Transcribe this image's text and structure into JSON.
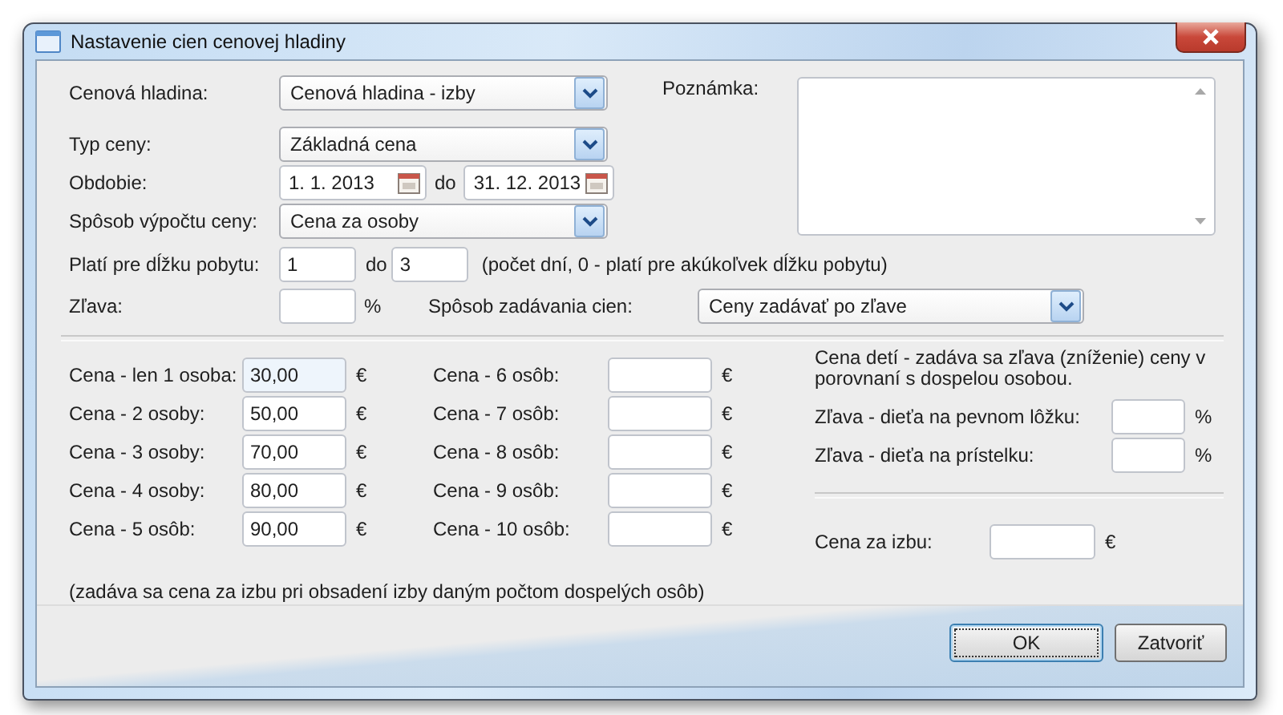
{
  "window": {
    "title": "Nastavenie cien cenovej hladiny"
  },
  "price_level": {
    "label": "Cenová hladina:",
    "value": "Cenová hladina - izby"
  },
  "price_type": {
    "label": "Typ ceny:",
    "value": "Základná cena"
  },
  "period": {
    "label": "Obdobie:",
    "from": "1. 1. 2013",
    "separator": "do",
    "to": "31. 12. 2013"
  },
  "calc_method": {
    "label": "Spôsob výpočtu ceny:",
    "value": "Cena za osoby"
  },
  "note": {
    "label": "Poznámka:"
  },
  "stay_length": {
    "label": "Platí pre dĺžku pobytu:",
    "from": "1",
    "separator": "do",
    "to": "3",
    "hint": "(počet dní,  0 - platí pre akúkoľvek dĺžku pobytu)"
  },
  "discount": {
    "label": "Zľava:",
    "unit": "%"
  },
  "entry_method": {
    "label": "Spôsob zadávania cien:",
    "value": "Ceny zadávať po zľave"
  },
  "prices_left": [
    {
      "label": "Cena - len 1 osoba:",
      "value": "30,00",
      "unit": "€",
      "focused": true
    },
    {
      "label": "Cena - 2 osoby:",
      "value": "50,00",
      "unit": "€",
      "focused": false
    },
    {
      "label": "Cena - 3 osoby:",
      "value": "70,00",
      "unit": "€",
      "focused": false
    },
    {
      "label": "Cena - 4 osoby:",
      "value": "80,00",
      "unit": "€",
      "focused": false
    },
    {
      "label": "Cena - 5 osôb:",
      "value": "90,00",
      "unit": "€",
      "focused": false
    }
  ],
  "prices_right": [
    {
      "label": "Cena - 6 osôb:",
      "unit": "€"
    },
    {
      "label": "Cena - 7 osôb:",
      "unit": "€"
    },
    {
      "label": "Cena - 8 osôb:",
      "unit": "€"
    },
    {
      "label": "Cena - 9 osôb:",
      "unit": "€"
    },
    {
      "label": "Cena - 10 osôb:",
      "unit": "€"
    }
  ],
  "children": {
    "note": "Cena detí - zadáva sa zľava (zníženie) ceny v porovnaní s dospelou osobou.",
    "discounts": [
      {
        "label": "Zľava - dieťa na pevnom lôžku:",
        "unit": "%"
      },
      {
        "label": "Zľava - dieťa na prístelku:",
        "unit": "%"
      }
    ]
  },
  "room_price": {
    "label": "Cena za izbu:",
    "unit": "€"
  },
  "footnote": "(zadáva sa cena za izbu pri obsadení izby daným počtom dospelých osôb)",
  "buttons": [
    {
      "label": "OK",
      "default": true
    },
    {
      "label": "Zatvoriť",
      "default": false
    }
  ]
}
